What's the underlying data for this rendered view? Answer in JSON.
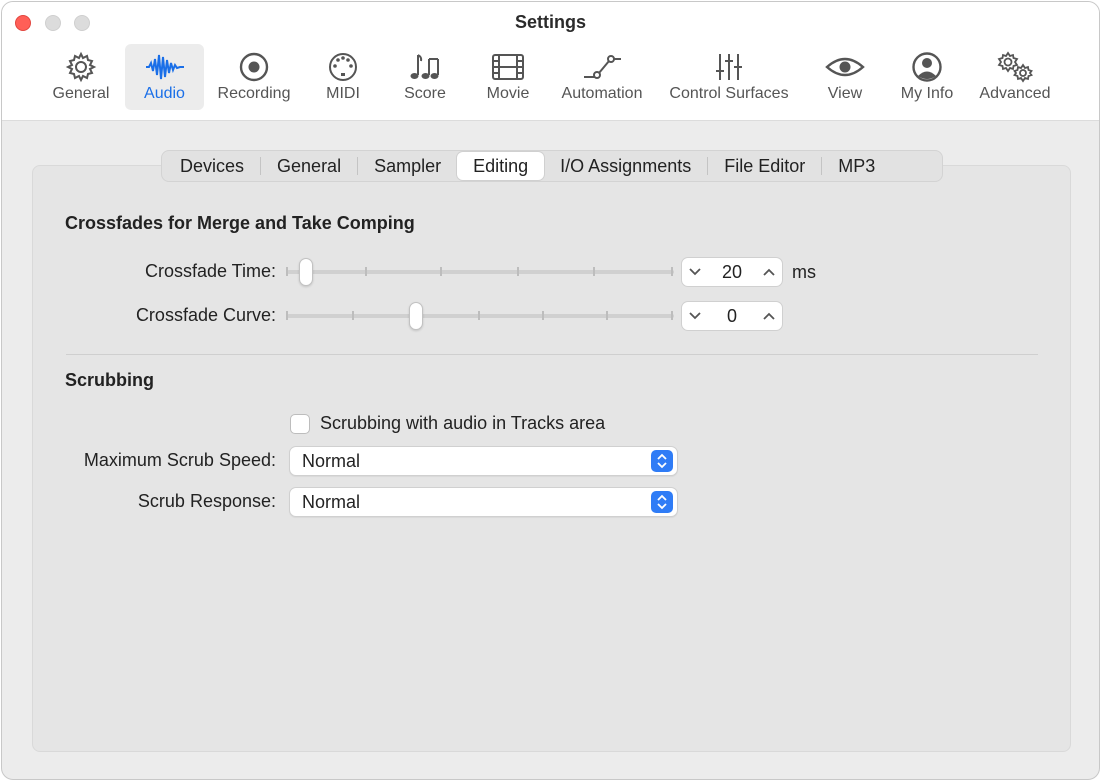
{
  "window": {
    "title": "Settings"
  },
  "toolbar": {
    "selected": "Audio",
    "accent_color": "#1a6fe8",
    "items": [
      {
        "label": "General",
        "icon": "gear-icon"
      },
      {
        "label": "Audio",
        "icon": "waveform-icon"
      },
      {
        "label": "Recording",
        "icon": "record-icon"
      },
      {
        "label": "MIDI",
        "icon": "midi-icon"
      },
      {
        "label": "Score",
        "icon": "music-notes-icon"
      },
      {
        "label": "Movie",
        "icon": "film-icon"
      },
      {
        "label": "Automation",
        "icon": "automation-icon"
      },
      {
        "label": "Control Surfaces",
        "icon": "sliders-icon"
      },
      {
        "label": "View",
        "icon": "eye-icon"
      },
      {
        "label": "My Info",
        "icon": "person-icon"
      },
      {
        "label": "Advanced",
        "icon": "gears-icon"
      }
    ]
  },
  "tabs": {
    "selected": "Editing",
    "items": [
      "Devices",
      "General",
      "Sampler",
      "Editing",
      "I/O Assignments",
      "File Editor",
      "MP3"
    ]
  },
  "crossfades": {
    "section_title": "Crossfades for Merge and Take Comping",
    "crossfade_time": {
      "label": "Crossfade Time:",
      "value": "20",
      "unit": "ms"
    },
    "crossfade_curve": {
      "label": "Crossfade Curve:",
      "value": "0"
    }
  },
  "scrubbing": {
    "section_title": "Scrubbing",
    "checkbox_label": "Scrubbing with audio in Tracks area",
    "checkbox_checked": false,
    "max_speed": {
      "label": "Maximum Scrub Speed:",
      "value": "Normal"
    },
    "response": {
      "label": "Scrub Response:",
      "value": "Normal"
    }
  }
}
